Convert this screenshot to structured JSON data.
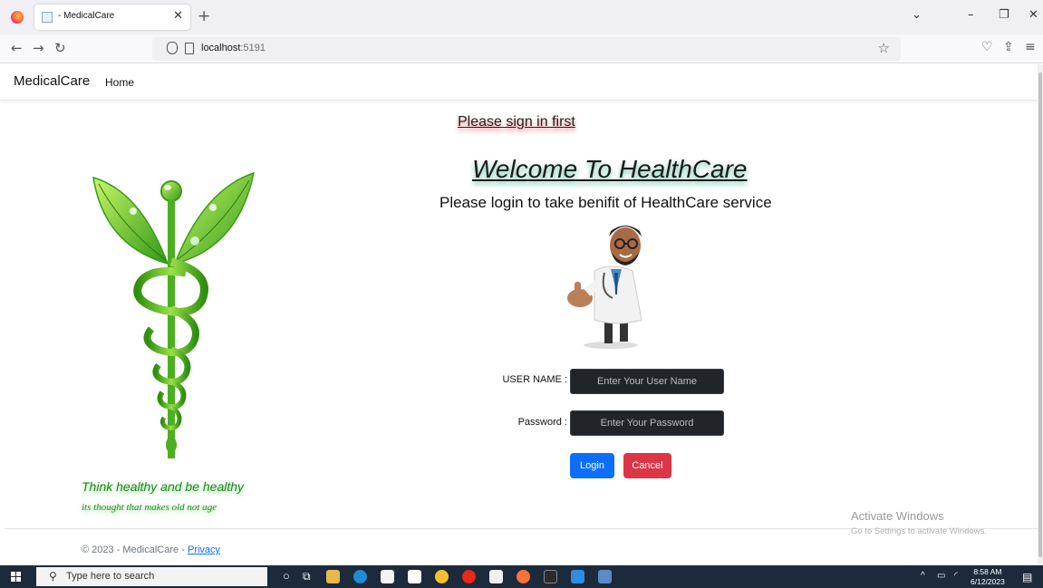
{
  "browser": {
    "tab_title": "- MedicalCare",
    "new_tab": "+",
    "url_host": "localhost",
    "url_port": ":5191"
  },
  "site": {
    "brand": "MedicalCare",
    "nav_home": "Home"
  },
  "main": {
    "signin_message": "Please sign in first",
    "welcome": "Welcome To HealthCare",
    "subtitle": "Please login to take benifit of HealthCare service",
    "username_label": "USER NAME :",
    "username_placeholder": "Enter Your User Name",
    "password_label": "Password :",
    "password_placeholder": "Enter Your Password",
    "login_button": "Login",
    "cancel_button": "Cancel",
    "tagline": "Think healthy and be healthy",
    "tagline_sub": "its thought that makes old not age"
  },
  "footer": {
    "copyright": "© 2023 - MedicalCare - ",
    "privacy_link": "Privacy"
  },
  "watermark": {
    "title": "Activate Windows",
    "subtitle": "Go to Settings to activate Windows."
  },
  "taskbar": {
    "search_placeholder": "Type here to search",
    "time": "8:58 AM",
    "date": "6/12/2023"
  },
  "colors": {
    "login_button": "#0d6efd",
    "cancel_button": "#dc3545",
    "input_background": "#212529",
    "tagline": "#1a8a1a",
    "taskbar": "#1c2a3c"
  }
}
